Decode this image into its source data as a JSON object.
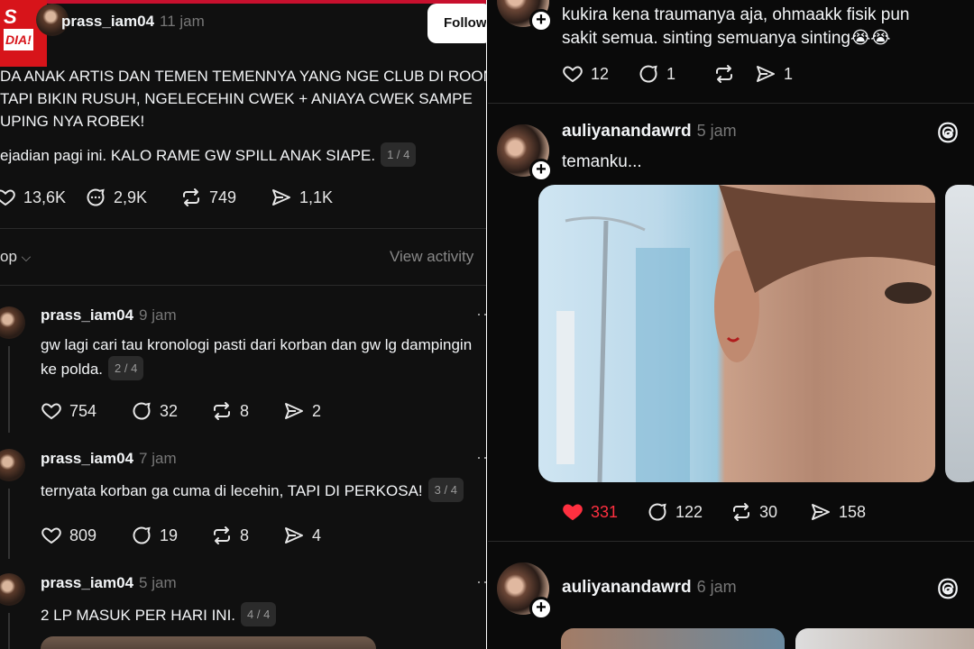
{
  "left": {
    "logo_line1": "S",
    "logo_line2": "DIA!",
    "post": {
      "username": "prass_iam04",
      "time": "11 jam",
      "follow_label": "Follow",
      "text_lines": [
        "DA ANAK ARTIS DAN TEMEN TEMENNYA YANG NGE CLUB DI ROOM",
        "TAPI BIKIN RUSUH, NGELECEHIN CWEK + ANIAYA CWEK SAMPE",
        "UPING NYA ROBEK!"
      ],
      "text_line4": "ejadian pagi ini. KALO RAME GW SPILL ANAK SIAPE.",
      "page_pill": "1 / 4",
      "likes": "13,6K",
      "comments": "2,9K",
      "reposts": "749",
      "shares": "1,1K"
    },
    "sort_label": "op",
    "view_activity": "View activity",
    "replies": [
      {
        "username": "prass_iam04",
        "time": "9 jam",
        "line1": "gw lagi cari tau kronologi pasti dari korban dan gw lg dampingin",
        "line2": "ke polda.",
        "pill": "2 / 4",
        "likes": "754",
        "comments": "32",
        "reposts": "8",
        "shares": "2"
      },
      {
        "username": "prass_iam04",
        "time": "7 jam",
        "line1": "ternyata korban ga cuma di lecehin, TAPI DI PERKOSA!",
        "pill": "3 / 4",
        "likes": "809",
        "comments": "19",
        "reposts": "8",
        "shares": "4"
      },
      {
        "username": "prass_iam04",
        "time": "5 jam",
        "line1": "2 LP MASUK PER HARI INI.",
        "pill": "4 / 4"
      }
    ]
  },
  "right": {
    "top_post": {
      "line1": "kukira kena traumanya aja, ohmaakk fisik pun",
      "line2": "sakit semua. sinting semuanya sinting😭😭",
      "likes": "12",
      "comments": "1",
      "shares": "1"
    },
    "post2": {
      "username": "auliyanandawrd",
      "time": "5 jam",
      "text": "temanku...",
      "likes": "331",
      "comments": "122",
      "reposts": "30",
      "shares": "158"
    },
    "post3": {
      "username": "auliyanandawrd",
      "time": "6 jam"
    }
  },
  "colors": {
    "like_red": "#ff3040",
    "brand_red": "#d7141a",
    "bg": "#101010"
  }
}
